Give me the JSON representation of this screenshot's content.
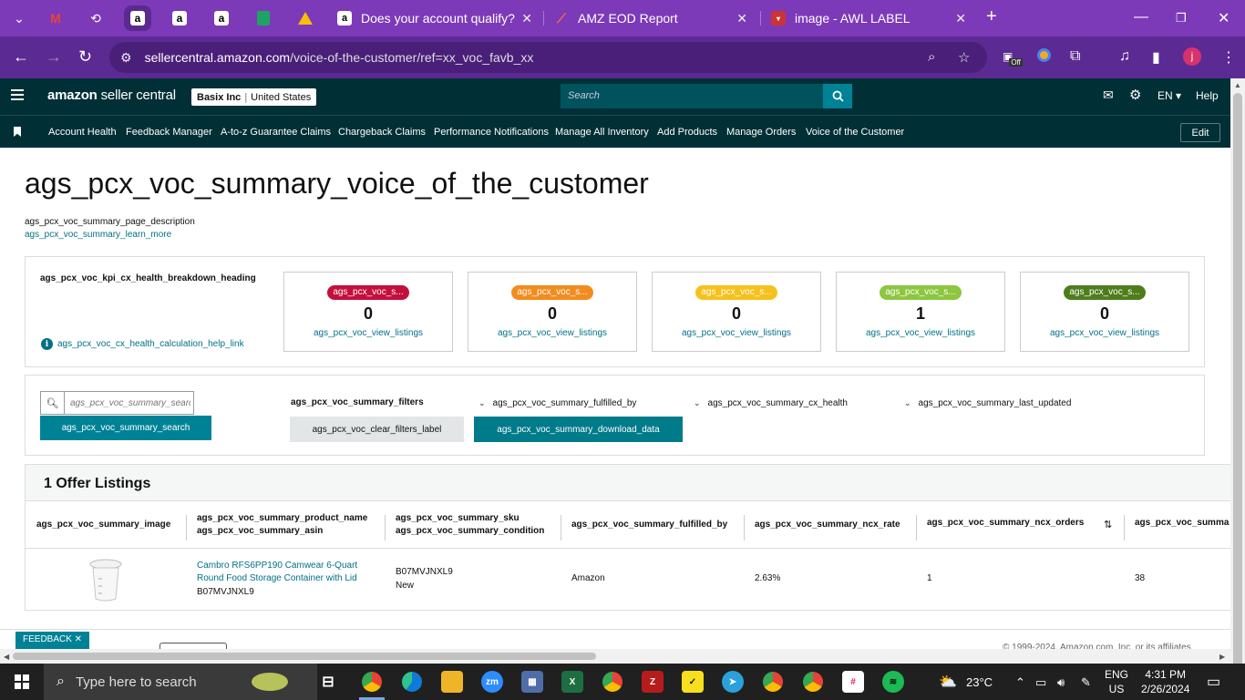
{
  "browser": {
    "tabs": [
      {
        "title": "Does your account qualify?"
      },
      {
        "title": "AMZ EOD Report"
      },
      {
        "title": "image - AWL LABEL"
      }
    ],
    "url_host": "sellercentral.amazon.com",
    "url_path": "/voice-of-the-customer/ref=xx_voc_favb_xx",
    "profile_initial": "j",
    "ext_off_label": "Off"
  },
  "header": {
    "logo_brand": "amazon",
    "logo_product": "seller central",
    "store_name": "Basix Inc",
    "store_region": "United States",
    "search_placeholder": "Search",
    "language": "EN",
    "help": "Help"
  },
  "nav": {
    "links": [
      "Account Health",
      "Feedback Manager",
      "A-to-z Guarantee Claims",
      "Chargeback Claims",
      "Performance Notifications",
      "Manage All Inventory",
      "Add Products",
      "Manage Orders",
      "Voice of the Customer"
    ],
    "edit": "Edit"
  },
  "page": {
    "title": "ags_pcx_voc_summary_voice_of_the_customer",
    "description": "ags_pcx_voc_summary_page_description",
    "learn_more": "ags_pcx_voc_summary_learn_more"
  },
  "kpi": {
    "heading": "ags_pcx_voc_kpi_cx_health_breakdown_heading",
    "help_link": "ags_pcx_voc_cx_health_calculation_help_link",
    "cards": [
      {
        "badge": "ags_pcx_voc_s...",
        "value": "0",
        "link": "ags_pcx_voc_view_listings",
        "color": "#c40f3d"
      },
      {
        "badge": "ags_pcx_voc_s...",
        "value": "0",
        "link": "ags_pcx_voc_view_listings",
        "color": "#f28c1e"
      },
      {
        "badge": "ags_pcx_voc_s...",
        "value": "0",
        "link": "ags_pcx_voc_view_listings",
        "color": "#f6c11c"
      },
      {
        "badge": "ags_pcx_voc_s...",
        "value": "1",
        "link": "ags_pcx_voc_view_listings",
        "color": "#8dc63f"
      },
      {
        "badge": "ags_pcx_voc_s...",
        "value": "0",
        "link": "ags_pcx_voc_view_listings",
        "color": "#4e7d1c"
      }
    ]
  },
  "filters": {
    "search_placeholder": "ags_pcx_voc_summary_search_placeholder",
    "search_button": "ags_pcx_voc_summary_search",
    "filters_label": "ags_pcx_voc_summary_filters",
    "clear_button": "ags_pcx_voc_clear_filters_label",
    "download_button": "ags_pcx_voc_summary_download_data",
    "dropdowns": [
      "ags_pcx_voc_summary_fulfilled_by",
      "ags_pcx_voc_summary_cx_health",
      "ags_pcx_voc_summary_last_updated"
    ]
  },
  "listings": {
    "title": "1 Offer Listings",
    "columns": {
      "image": "ags_pcx_voc_summary_image",
      "product_name": "ags_pcx_voc_summary_product_name",
      "asin": "ags_pcx_voc_summary_asin",
      "sku": "ags_pcx_voc_summary_sku",
      "condition": "ags_pcx_voc_summary_condition",
      "fulfilled_by": "ags_pcx_voc_summary_fulfilled_by",
      "ncx_rate": "ags_pcx_voc_summary_ncx_rate",
      "ncx_orders": "ags_pcx_voc_summary_ncx_orders",
      "next": "ags_pcx_voc_summa"
    },
    "rows": [
      {
        "product_name_line1": "Cambro RFS6PP190 Camwear 6-Quart",
        "product_name_line2": "Round Food Storage Container with Lid",
        "asin": "B07MVJNXL9",
        "sku": "B07MVJNXL9",
        "condition": "New",
        "fulfilled_by": "Amazon",
        "ncx_rate": "2.63%",
        "ncx_orders": "1",
        "next": "38"
      }
    ]
  },
  "footer": {
    "feedback": "FEEDBACK",
    "copyright": "© 1999-2024, Amazon.com, Inc. or its affiliates"
  },
  "taskbar": {
    "search_text": "Type here to search",
    "weather": "23°C",
    "lang_line1": "ENG",
    "lang_line2": "US",
    "time": "4:31 PM",
    "date": "2/26/2024"
  }
}
